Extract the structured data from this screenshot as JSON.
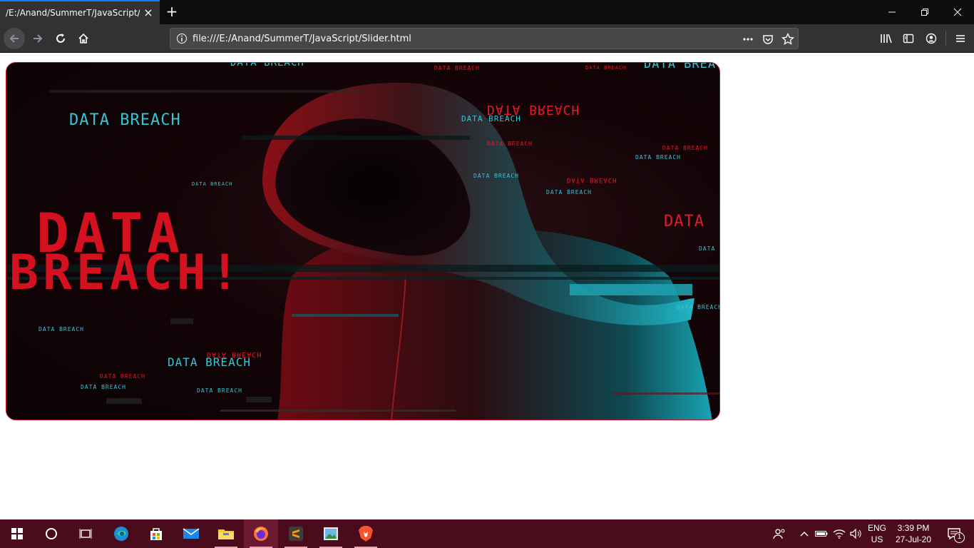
{
  "browser": {
    "tab_title": "/E:/Anand/SummerT/JavaScript/Slider.html",
    "url": "file:///E:/Anand/SummerT/JavaScript/Slider.html",
    "accent": "#0a84ff"
  },
  "slider": {
    "headline_line1": "DATA",
    "headline_line2": "BREACH!",
    "texts": {
      "t1": "DATA BREACH",
      "t2": "DATA BREACH",
      "t3": "DATA BREACH",
      "t4": "DATA BREACH",
      "t5": "DATA BREACH",
      "t6": "DATA BREACH",
      "t7": "DATA BREACH",
      "t8": "DATA BREACH",
      "t9": "DATA BREACH",
      "t10": "DATA BREACH",
      "t11": "DATA BREACH",
      "t12": "DATA BREACH",
      "t13": "DATA BREACH",
      "t14": "DATA",
      "t15": "DATA B",
      "t16": "DATA BREACH",
      "t17": "DATA BREACH",
      "t18": "DATA BREACH",
      "t19": "DATA BREACH",
      "t20": "DATA BREACH",
      "t21": "DATA BREACH",
      "t22": "DATA BREACH",
      "t23": "DATA BREACH"
    },
    "colors": {
      "cyan": "#35c6d6",
      "red": "#e21a2a",
      "border": "#c8102e"
    }
  },
  "taskbar": {
    "lang_top": "ENG",
    "lang_bottom": "US",
    "time": "3:39 PM",
    "date": "27-Jul-20",
    "notification_count": "1",
    "bg": "#4a0b1c"
  }
}
